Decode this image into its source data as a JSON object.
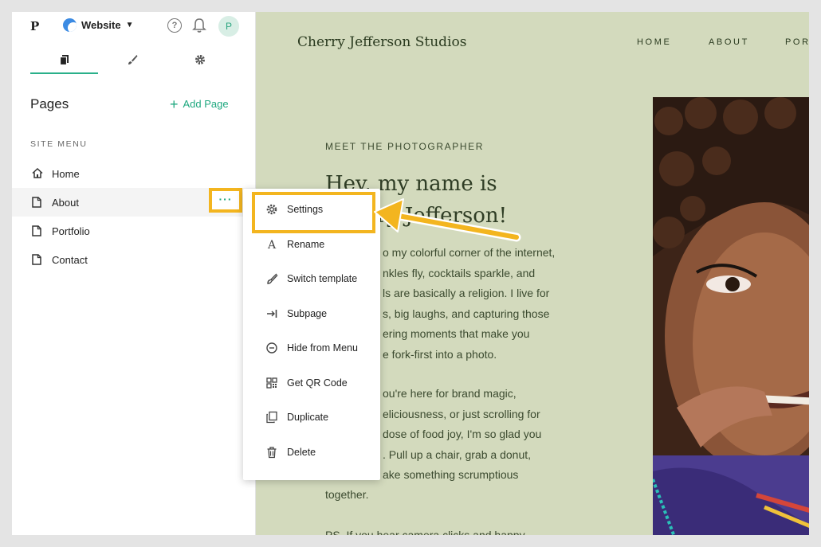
{
  "topbar": {
    "logo": "P",
    "site_name": "Website",
    "help": "?",
    "avatar": "P"
  },
  "tabs": [
    {
      "icon": "pages-icon"
    },
    {
      "icon": "brush-icon"
    },
    {
      "icon": "gear-icon"
    }
  ],
  "pages": {
    "title": "Pages",
    "add_label": "Add Page",
    "section_label": "SITE MENU",
    "items": [
      {
        "label": "Home",
        "icon": "home-icon"
      },
      {
        "label": "About",
        "icon": "page-icon"
      },
      {
        "label": "Portfolio",
        "icon": "page-icon"
      },
      {
        "label": "Contact",
        "icon": "page-icon"
      }
    ],
    "more": "···"
  },
  "context_menu": {
    "items": [
      {
        "label": "Settings",
        "icon": "gear-icon"
      },
      {
        "label": "Rename",
        "icon": "rename-icon"
      },
      {
        "label": "Switch template",
        "icon": "brush-icon"
      },
      {
        "label": "Subpage",
        "icon": "indent-icon"
      },
      {
        "label": "Hide from Menu",
        "icon": "minus-circle-icon"
      },
      {
        "label": "Get QR Code",
        "icon": "qr-code-icon"
      },
      {
        "label": "Duplicate",
        "icon": "duplicate-icon"
      },
      {
        "label": "Delete",
        "icon": "trash-icon"
      }
    ]
  },
  "preview": {
    "brand": "Cherry Jefferson Studios",
    "nav": [
      "HOME",
      "ABOUT",
      "POR"
    ],
    "eyebrow": "MEET THE PHOTOGRAPHER",
    "headline_1": "Hey, my name is",
    "headline_2": "Cherry Jefferson!",
    "para1": [
      "o my colorful corner of the internet,",
      "nkles fly, cocktails sparkle, and",
      "ls are basically a religion. I live for",
      "s, big laughs, and capturing those",
      "ering moments that make you",
      "e fork-first into a photo."
    ],
    "para2": [
      "ou're here for brand magic,",
      "eliciousness, or just scrolling for",
      "dose of food joy, I'm so glad you",
      ". Pull up a chair, grab a donut,",
      "ake something scrumptious",
      "together."
    ],
    "para3": "PS. If you hear camera clicks and happy"
  },
  "colors": {
    "accent": "#1fa87f",
    "highlight": "#f3b51f",
    "preview_bg": "#d3dabd"
  }
}
